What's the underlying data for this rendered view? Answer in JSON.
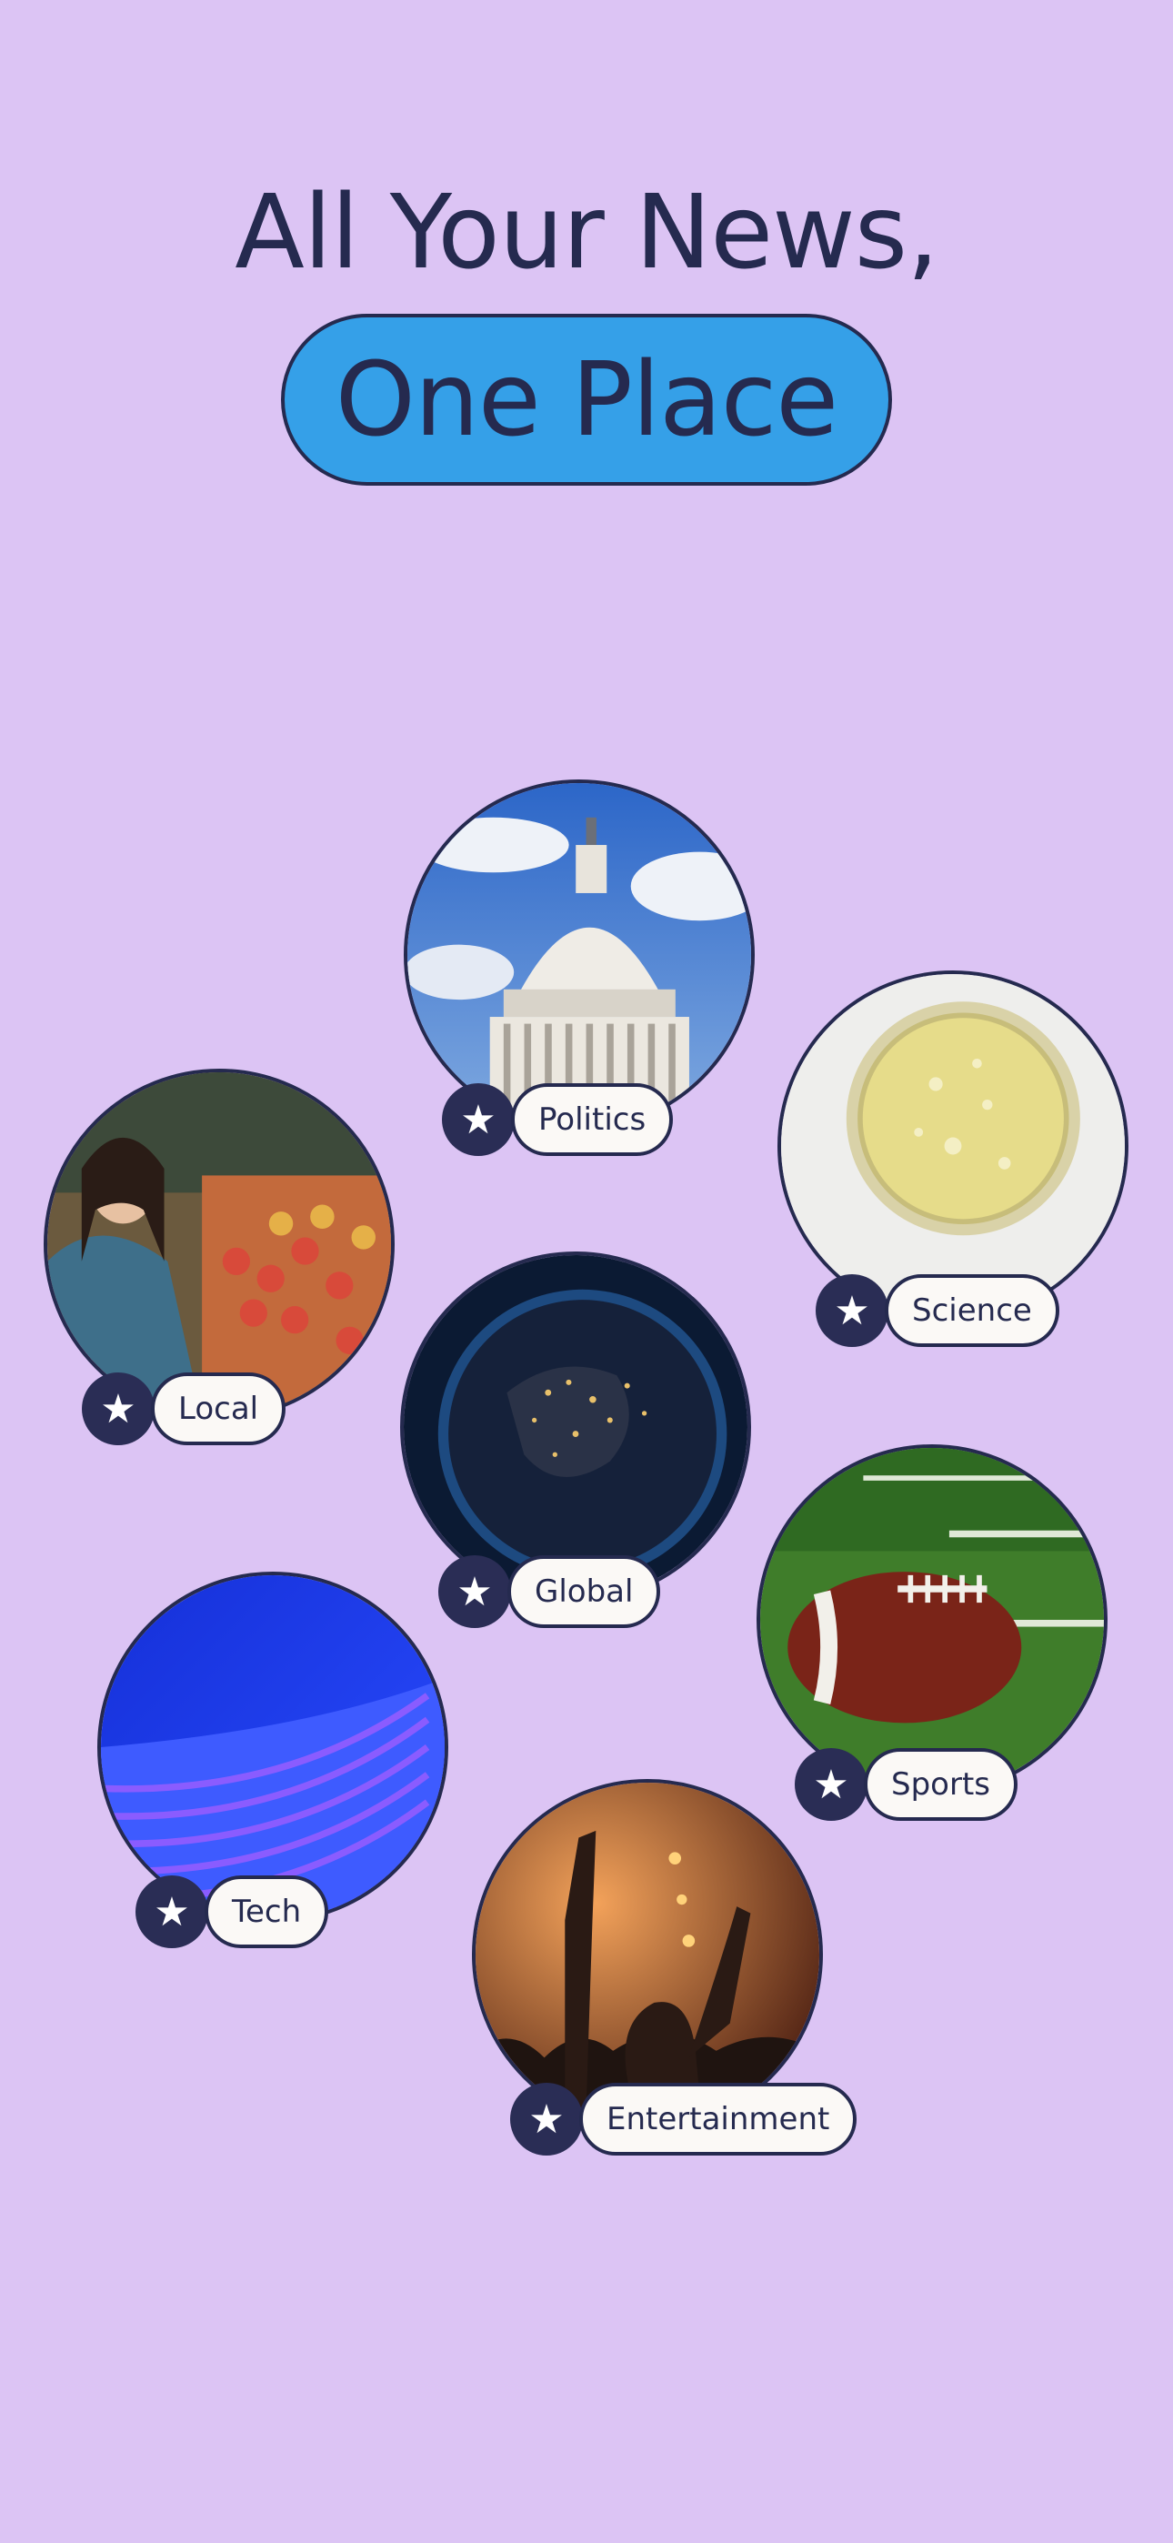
{
  "headline": {
    "line1": "All Your News,",
    "line2": "One Place"
  },
  "categories": [
    {
      "label": "Politics",
      "icon": "star-icon",
      "image": "capitol-dome"
    },
    {
      "label": "Science",
      "icon": "star-icon",
      "image": "petri-dish"
    },
    {
      "label": "Local",
      "icon": "star-icon",
      "image": "market-shopper"
    },
    {
      "label": "Global",
      "icon": "star-icon",
      "image": "earth-at-night"
    },
    {
      "label": "Sports",
      "icon": "star-icon",
      "image": "football-on-field"
    },
    {
      "label": "Tech",
      "icon": "star-icon",
      "image": "abstract-blue-waves"
    },
    {
      "label": "Entertainment",
      "icon": "star-icon",
      "image": "concert-crowd"
    }
  ],
  "colors": {
    "background": "#dcc4f4",
    "accent": "#35a0e8",
    "ink": "#252a4f"
  }
}
